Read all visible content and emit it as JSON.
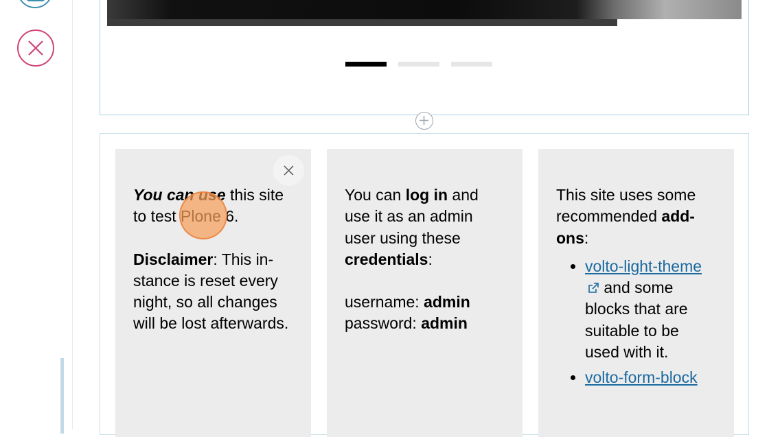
{
  "toolbar": {
    "top_icon": "edit-icon",
    "close_icon": "close-icon",
    "accent_top": "#3f8fb0",
    "accent_close": "#d0457a"
  },
  "slider": {
    "dots_count": 3,
    "active_dot": 1
  },
  "grid": {
    "col1": {
      "p1_lead": "You can use",
      "p1_rest": " this site to test Plone 6.",
      "p2_lead": "Disclaimer",
      "p2_rest": ": This in­stance is reset every night, so all changes will be lost afterwards."
    },
    "col2": {
      "t1": "You can ",
      "b1": "log in",
      "t2": " and use it as an admin user using these ",
      "b2": "credentials",
      "t3": ":",
      "user_label": "username: ",
      "user_value": "admin",
      "pass_label": "password: ",
      "pass_value": "admin"
    },
    "col3": {
      "t1": "This site uses some recommended ",
      "b1": "add-ons",
      "t2": ":",
      "item1_link": "volto-light-theme",
      "item1_rest": " and some blocks that are suitable to be used with it.",
      "item2_link": "volto-form-block"
    }
  }
}
